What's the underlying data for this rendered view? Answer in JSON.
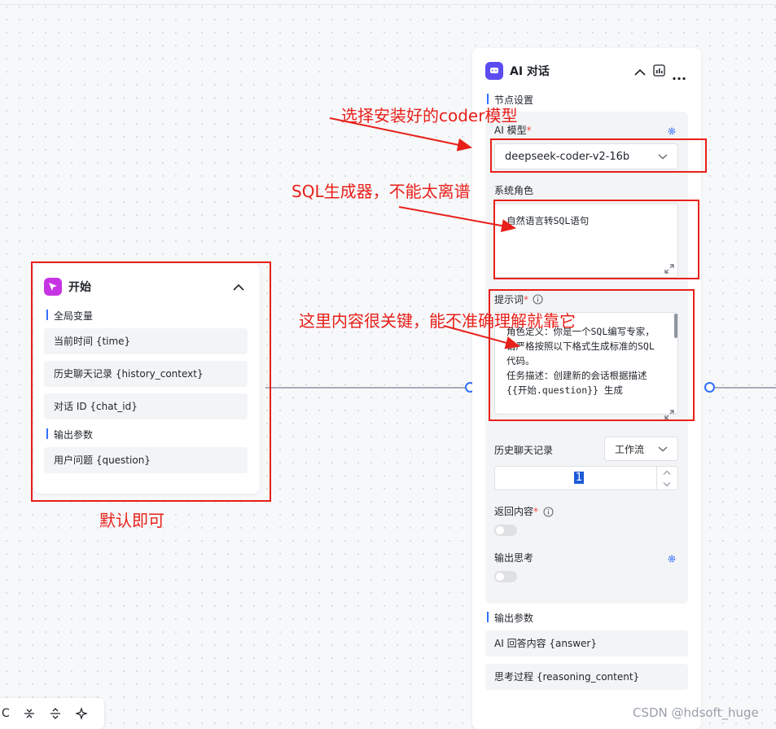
{
  "start_node": {
    "title": "开始",
    "global_vars_label": "全局变量",
    "global_vars": [
      "当前时间 {time}",
      "历史聊天记录 {history_context}",
      "对话 ID {chat_id}"
    ],
    "output_label": "输出参数",
    "outputs": [
      "用户问题 {question}"
    ]
  },
  "ai_node": {
    "title": "AI 对话",
    "node_settings_label": "节点设置",
    "model_label": "AI 模型",
    "model_value": "deepseek-coder-v2-16b",
    "system_role_label": "系统角色",
    "system_role_value": "自然语言转SQL语句",
    "prompt_label": "提示词",
    "prompt_value": "角色定义：你是一个SQL编写专家，请严格按照以下格式生成标准的SQL代码。\n任务描述：创建新的会话根据描述 {{开始.question}} 生成",
    "history_label": "历史聊天记录",
    "history_mode": "工作流",
    "history_count": "1",
    "return_label": "返回内容",
    "think_label": "输出思考",
    "output_label": "输出参数",
    "outputs": [
      "AI 回答内容 {answer}",
      "思考过程 {reasoning_content}"
    ]
  },
  "annotations": {
    "model_note": "选择安装好的coder模型",
    "role_note": "SQL生成器，不能太离谱",
    "prompt_note": "这里内容很关键，能不准确理解就靠它",
    "start_note": "默认即可"
  },
  "toolbar": {
    "left_glyph": "C"
  },
  "watermark": "CSDN @hdsoft_huge",
  "colors": {
    "accent": "#3370ff",
    "annotation": "#e8201a",
    "start_icon": "#c734e3",
    "ai_icon": "#5b4cf0"
  },
  "icons": [
    "cursor-icon",
    "chat-icon",
    "chevron-up-icon",
    "chart-icon",
    "more-icon",
    "gear-icon",
    "chevron-down-icon",
    "info-icon",
    "expand-icon"
  ]
}
